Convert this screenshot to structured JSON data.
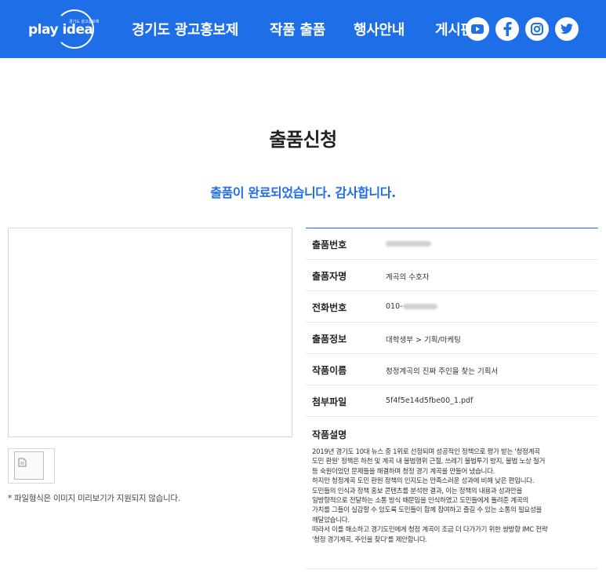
{
  "header": {
    "logo_text": "play idea",
    "logo_small": "경기도 광고홍보제",
    "nav": [
      "경기도 광고홍보제",
      "작품 출품",
      "행사안내",
      "게시판"
    ],
    "social": [
      "youtube-icon",
      "facebook-icon",
      "instagram-icon",
      "twitter-icon"
    ],
    "accent": "#1e6ee8"
  },
  "page": {
    "title": "출품신청",
    "complete_message": "출품이 완료되었습니다. 감사합니다."
  },
  "preview": {
    "note": "* 파일형식은 이미지 미리보기가 지원되지 않습니다."
  },
  "info": {
    "rows": [
      {
        "label": "출품번호",
        "value": ""
      },
      {
        "label": "출품자명",
        "value": "계곡의 수호자"
      },
      {
        "label": "전화번호",
        "value": "010-"
      },
      {
        "label": "출품정보",
        "value": "대학생부 > 기획/마케팅"
      },
      {
        "label": "작품이름",
        "value": "청정계곡의 진짜 주인을 찾는 기획서"
      },
      {
        "label": "첨부파일",
        "value": "5f4f5e14d5fbe00_1.pdf"
      }
    ],
    "description_label": "작품설명",
    "description_lines": [
      "2019년 경기도 10대 뉴스 중 1위로 선정되며 성공적인 정책으로 평가 받는 '청정계곡",
      "도민 환원' 정책은 하천 및 계곡 내 불법행위 근절, 쓰레기 불법투기 방지, 불법 노상 철거",
      "등 숙원이었던 문제들을 해결하며 청정 경기 계곡을 만들어 냈습니다.",
      "하지만 청정계곡 도민 환원 정책의 인지도는 만족스러운 성과에 비해 낮은 편입니다.",
      "도민들의 인식과 정책 홍보 콘텐츠를 분석한 결과, 이는 정책의 내용과 성과만을",
      "일방향적으로 전달하는 소통 방식 때문임을 인식하였고 도민들에게 돌려준 계곡의",
      "가치를 그들이 실감할 수 있도록 도민들이 함께 참여하고 즐길 수 있는 소통의 필요성을",
      "깨달았습니다.",
      "따라서 이를 해소하고 경기도민에게 청정 계곡이 조금 더 다가가기 위한 쌍방향 IMC 전략",
      "'청정 경기계곡, 주인을 찾다'를 제안합니다."
    ]
  }
}
